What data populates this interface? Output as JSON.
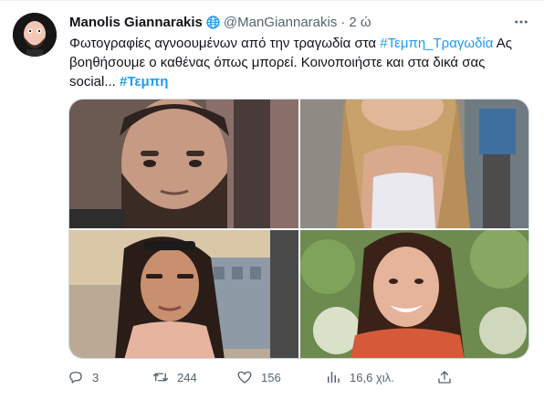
{
  "tweet": {
    "author_name": "Manolis Giannarakis",
    "handle": "@ManGiannarakis",
    "separator": "·",
    "time": "2 ώ",
    "text_part1": "Φωτογραφίες αγνοουμένων από την τραγωδία στα ",
    "hashtag1": "#Τεμπη_Τραγωδία",
    "text_part2": " Ας βοηθήσουμε ο καθένας όπως μπορεί. Κοινοποιήστε και στα δικά σας social... ",
    "hashtag2": "#Τεμπη"
  },
  "icons": {
    "verified": "globe-badge-icon",
    "more": "more-dots-icon",
    "reply": "reply-icon",
    "retweet": "retweet-icon",
    "like": "heart-icon",
    "views": "views-chart-icon",
    "share": "share-icon"
  },
  "actions": {
    "replies": "3",
    "retweets": "244",
    "likes": "156",
    "views": "16,6 χιλ."
  },
  "colors": {
    "link": "#1d9bf0",
    "secondary_text": "#536471",
    "primary_text": "#0f1419"
  }
}
